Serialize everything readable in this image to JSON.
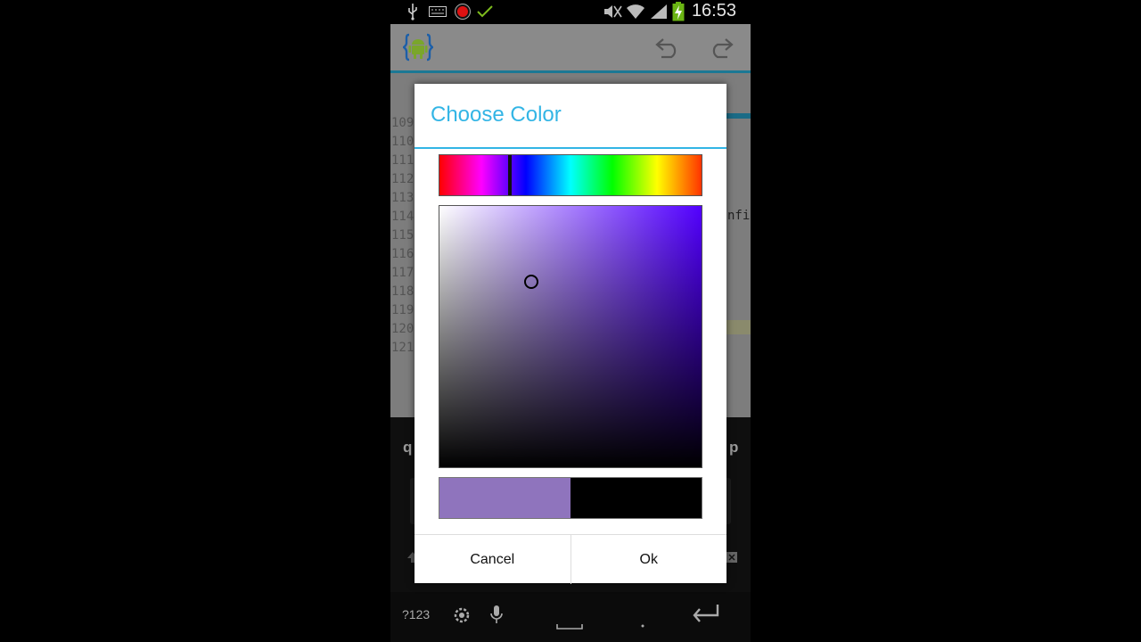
{
  "status_bar": {
    "time": "16:53",
    "icons": [
      "usb-icon",
      "keyboard-icon",
      "record-icon",
      "check-icon",
      "mute-icon",
      "wifi-icon",
      "signal-icon",
      "battery-charging-icon"
    ]
  },
  "action_bar": {
    "app_icon": "android-editor-icon",
    "undo_icon": "undo-icon",
    "redo_icon": "redo-icon"
  },
  "editor": {
    "line_numbers": [
      "109",
      "110",
      "111",
      "112",
      "113",
      "114",
      "115",
      "116",
      "117",
      "118",
      "119",
      "120",
      "121"
    ],
    "code_fragment": "nfi"
  },
  "keyboard": {
    "left_key": "q",
    "right_key": "p",
    "symbols_key": "?123"
  },
  "dialog": {
    "title": "Choose Color",
    "hue_position": 0.27,
    "saturation": 0.35,
    "value": 0.71,
    "new_color": "#8f74bd",
    "old_color": "#000000",
    "cancel_label": "Cancel",
    "ok_label": "Ok"
  },
  "colors": {
    "accent": "#33b5e5"
  }
}
